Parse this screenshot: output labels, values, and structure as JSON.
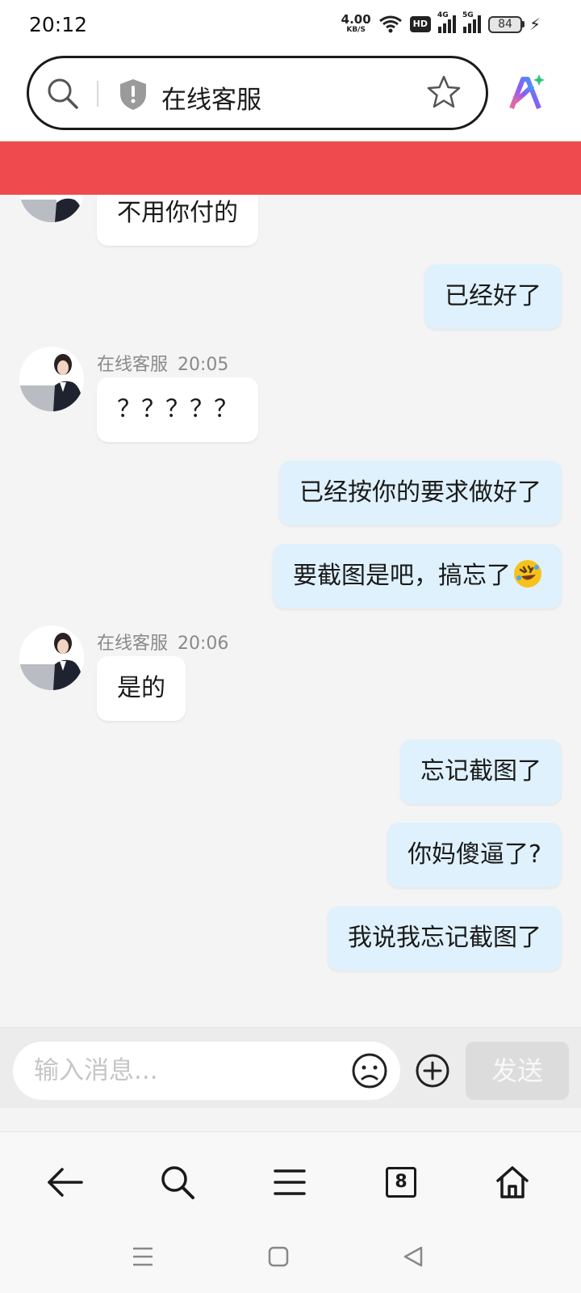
{
  "status_bar": {
    "time": "20:12",
    "net_speed": "4.00",
    "net_unit": "KB/S",
    "hd_badge": "HD",
    "signal1": "4G",
    "signal2": "5G",
    "battery": "84"
  },
  "browser": {
    "page_title": "在线客服"
  },
  "chat": {
    "messages": [
      {
        "side": "in",
        "text": "不用你付的"
      },
      {
        "side": "out",
        "text": "已经好了"
      },
      {
        "side": "in",
        "sender": "在线客服",
        "time": "20:05",
        "text": "？？？？？"
      },
      {
        "side": "out",
        "text": "已经按你的要求做好了"
      },
      {
        "side": "out",
        "text": "要截图是吧，搞忘了",
        "emoji": "rolling-on-floor-laughing-emoji"
      },
      {
        "side": "in",
        "sender": "在线客服",
        "time": "20:06",
        "text": "是的"
      },
      {
        "side": "out",
        "text": "忘记截图了"
      },
      {
        "side": "out",
        "text": "你妈傻逼了?"
      },
      {
        "side": "out",
        "text": "我说我忘记截图了"
      }
    ]
  },
  "composer": {
    "placeholder": "输入消息...",
    "send_label": "发送"
  },
  "bottom_nav": {
    "tab_count": "8"
  },
  "colors": {
    "banner": "#ef4b4e",
    "outgoing_bubble": "#dff1fc",
    "incoming_bubble": "#ffffff",
    "send_disabled": "#dcdcdc"
  }
}
